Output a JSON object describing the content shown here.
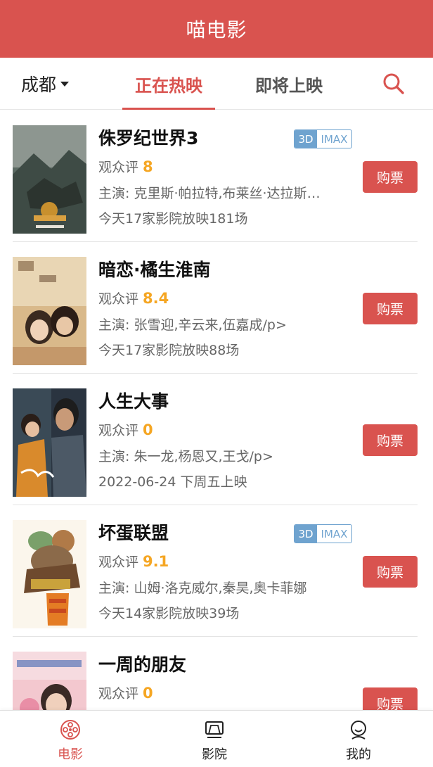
{
  "app": {
    "title": "喵电影"
  },
  "topnav": {
    "city": "成都",
    "tabs": [
      {
        "label": "正在热映",
        "active": true
      },
      {
        "label": "即将上映",
        "active": false
      }
    ]
  },
  "colors": {
    "brand": "#d9534f",
    "score": "#f5a623",
    "badge": "#6fa3cf"
  },
  "movies": [
    {
      "title": "侏罗纪世界3",
      "badges": [
        "3D",
        "IMAX"
      ],
      "score_label": "观众评",
      "score": "8",
      "actors": "主演: 克里斯·帕拉特,布莱丝·达拉斯·霍华德",
      "showinfo": "今天17家影院放映181场",
      "buy_label": "购票"
    },
    {
      "title": "暗恋·橘生淮南",
      "badges": [],
      "score_label": "观众评",
      "score": "8.4",
      "actors": "主演: 张雪迎,辛云来,伍嘉成/p>",
      "showinfo": "今天17家影院放映88场",
      "buy_label": "购票"
    },
    {
      "title": "人生大事",
      "badges": [],
      "score_label": "观众评",
      "score": "0",
      "actors": "主演: 朱一龙,杨恩又,王戈/p>",
      "showinfo": "2022-06-24 下周五上映",
      "buy_label": "购票"
    },
    {
      "title": "坏蛋联盟",
      "badges": [
        "3D",
        "IMAX"
      ],
      "score_label": "观众评",
      "score": "9.1",
      "actors": "主演: 山姆·洛克威尔,秦昊,奥卡菲娜",
      "showinfo": "今天14家影院放映39场",
      "buy_label": "购票"
    },
    {
      "title": "一周的朋友",
      "badges": [],
      "score_label": "观众评",
      "score": "0",
      "actors": "",
      "showinfo": "",
      "buy_label": "购票"
    }
  ],
  "tabbar": [
    {
      "label": "电影",
      "icon": "film-reel-icon",
      "active": true
    },
    {
      "label": "影院",
      "icon": "cinema-screen-icon",
      "active": false
    },
    {
      "label": "我的",
      "icon": "user-face-icon",
      "active": false
    }
  ]
}
